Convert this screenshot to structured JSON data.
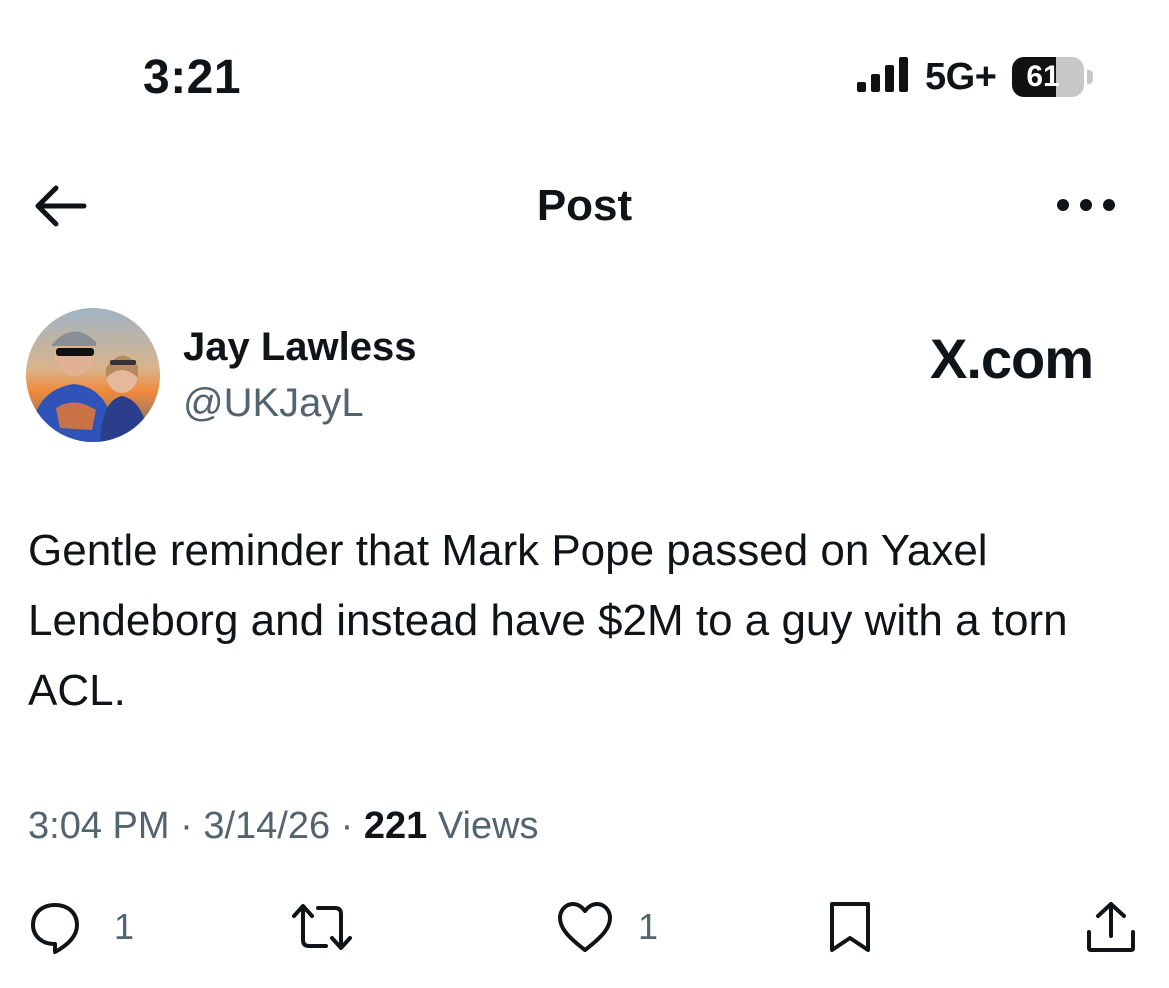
{
  "status_bar": {
    "time": "3:21",
    "network": "5G+",
    "battery": "61",
    "battery_level_percent": 61
  },
  "header": {
    "title": "Post",
    "back_icon": "arrow-left-icon",
    "more_icon": "more-horizontal-icon"
  },
  "author": {
    "name": "Jay Lawless",
    "handle": "@UKJayL",
    "avatar_icon": "profile-photo",
    "brand": "X.com"
  },
  "tweet": {
    "text": "Gentle reminder that Mark Pope passed on Yaxel Lendeborg and instead have $2M to a guy with a torn ACL."
  },
  "meta": {
    "time": "3:04 PM",
    "separator": "·",
    "date": "3/14/26",
    "views_count": "221",
    "views_label": "Views"
  },
  "actions": {
    "reply_count": "1",
    "like_count": "1",
    "icons": [
      "reply-icon",
      "retweet-icon",
      "like-icon",
      "bookmark-icon",
      "share-icon"
    ]
  },
  "colors": {
    "text_primary": "#0f1419",
    "text_secondary": "#536471",
    "background": "#ffffff"
  }
}
